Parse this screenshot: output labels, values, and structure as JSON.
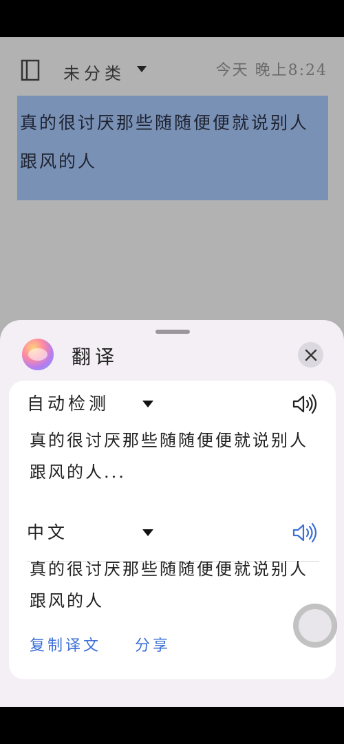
{
  "note": {
    "category": "未分类",
    "timestamp": "今天 晚上8:24",
    "body": "真的很讨厌那些随随便便就说别人跟风的人"
  },
  "sheet": {
    "title": "翻译",
    "source": {
      "language": "自动检测",
      "text": "真的很讨厌那些随随便便就说别人跟风的人..."
    },
    "target": {
      "language": "中文",
      "text": "真的很讨厌那些随随便便就说别人跟风的人"
    },
    "actions": {
      "copy": "复制译文",
      "share": "分享"
    }
  },
  "colors": {
    "accent": "#3b6fd6",
    "selection": "#7a91b6",
    "sheet_bg": "#f4eff5"
  },
  "icons": [
    "book-icon",
    "dropdown-arrow-icon",
    "close-icon",
    "speaker-icon",
    "app-logo-icon"
  ]
}
